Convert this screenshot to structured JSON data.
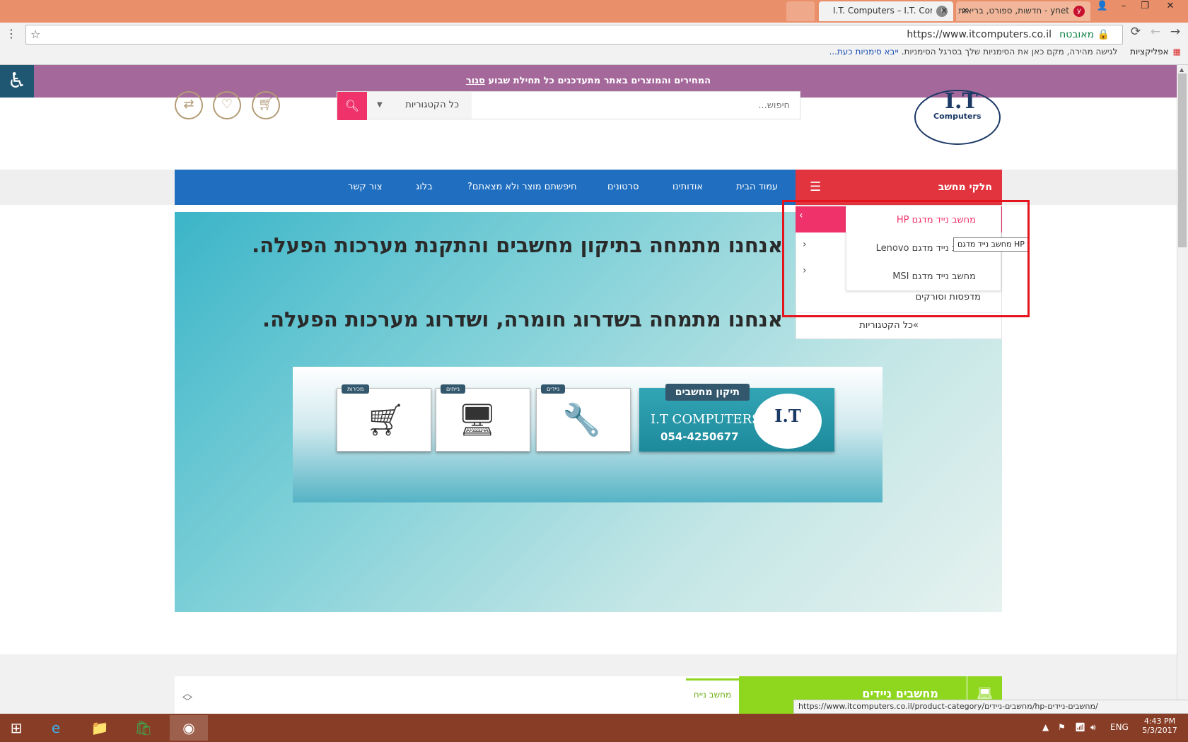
{
  "browser": {
    "tabs": [
      {
        "title": "I.T. Computers – I.T. Com",
        "active": true
      },
      {
        "title": "ynet - חדשות, ספורט, בריאות",
        "active": false
      }
    ],
    "url": "https://www.itcomputers.co.il",
    "secure_label": "מאובטח",
    "bookmarks": {
      "apps": "אפליקציות",
      "hint": "לגישה מהירה, מקם כאן את הסימניות שלך בסרגל הסימניות.",
      "import": "ייבא סימניות כעת..."
    },
    "status_url": "https://www.itcomputers.co.il/product-category/מחשבים-ניידים/hp-מחשבים-ניידים/"
  },
  "notice": {
    "text": "המחירים והמוצרים באתר מתעדכנים כל תחילת שבוע",
    "close": "סגור"
  },
  "header": {
    "logo_text": "I.T",
    "logo_sub": "Computers",
    "search_placeholder": "חיפוש...",
    "category_select": "כל הקטגוריות"
  },
  "nav": {
    "category_title": "חלקי מחשב",
    "items": [
      "עמוד הבית",
      "אודותינו",
      "סרטונים",
      "חיפשתם מוצר ולא מצאתם?",
      "בלוג",
      "צור קשר"
    ]
  },
  "category_menu": {
    "items": [
      "מדפסות וסורקים"
    ],
    "all": "»כל הקטגוריות",
    "submenu": [
      "מחשב נייד מדגם HP",
      "מחשב נייד מדגם Lenovo",
      "מחשב נייד מדגם MSI"
    ],
    "tooltip": "מחשב נייד מדגם HP"
  },
  "hero": {
    "line1": "אנחנו מתמחה בתיקון מחשבים והתקנת מערכות הפעלה.",
    "line2": "אנחנו מתמחה בשדרוג חומרה, ושדרוג מערכות הפעלה.",
    "banner": {
      "title": "תיקון מחשבים",
      "company": "I.T COMPUTERS",
      "phone": "054-4250677",
      "card_tags": [
        "ניידים",
        "נייחים",
        "מכירות"
      ]
    }
  },
  "lower": {
    "section_title": "מחשבים ניידים",
    "subtab": "מחשב נייח"
  },
  "taskbar": {
    "lang": "ENG",
    "time": "4:43 PM",
    "date": "5/3/2017"
  }
}
